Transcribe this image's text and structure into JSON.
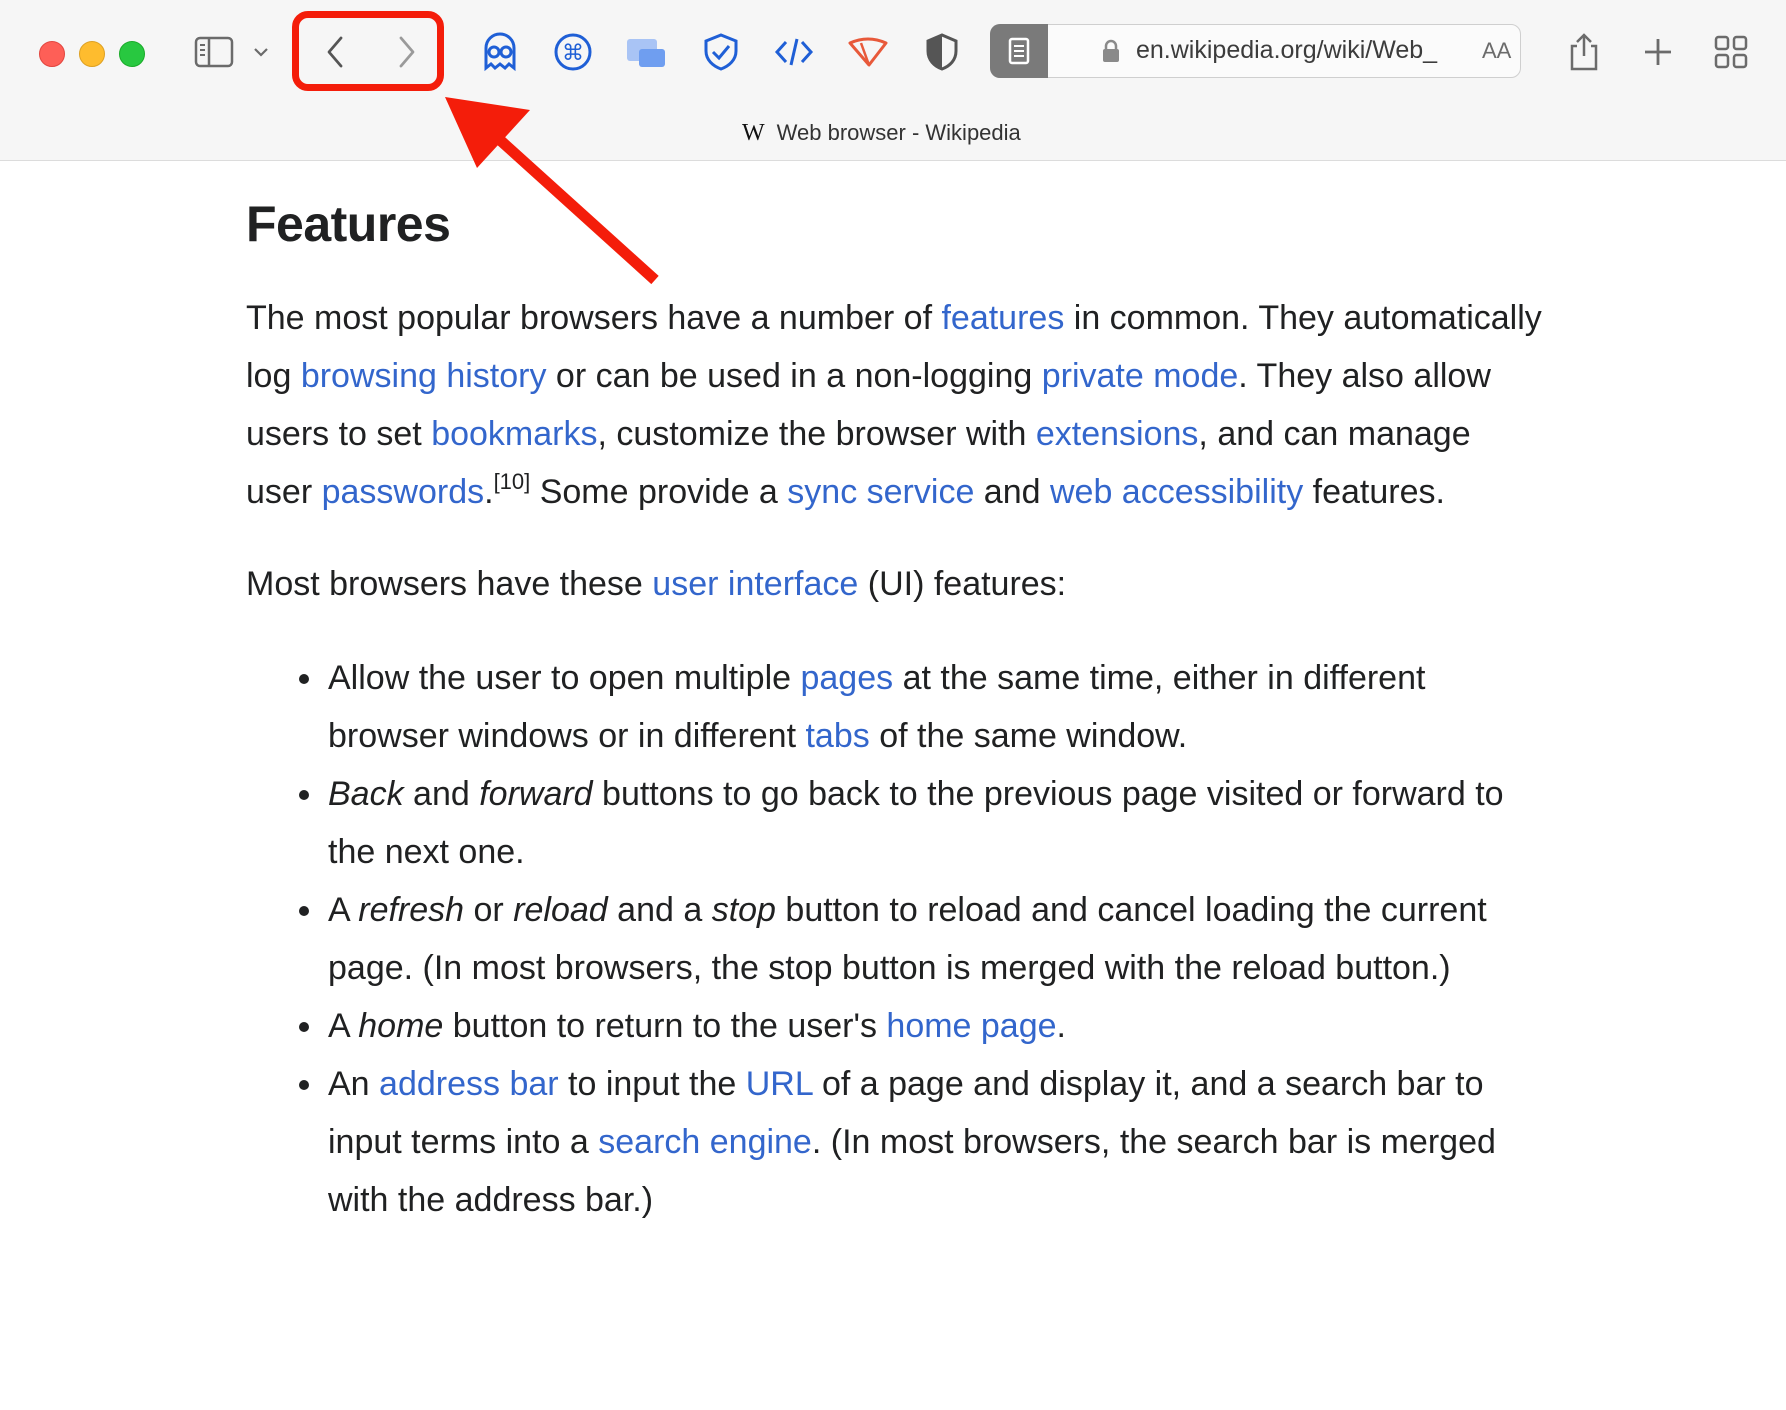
{
  "window": {
    "traffic_lights": [
      "close",
      "minimize",
      "zoom"
    ]
  },
  "toolbar": {
    "icons": [
      "sidebar-icon",
      "chevron-down-icon",
      "back-icon",
      "forward-icon",
      "ghost-extension-icon",
      "command-extension-icon",
      "picture-in-picture-extension-icon",
      "shield-check-extension-icon",
      "code-extension-icon",
      "wiper-extension-icon",
      "half-shield-extension-icon",
      "reader-icon",
      "share-icon",
      "new-tab-icon",
      "tab-overview-icon"
    ]
  },
  "address": {
    "url": "en.wikipedia.org/wiki/Web_",
    "aa": "AA"
  },
  "tab": {
    "logo": "W",
    "title": "Web browser - Wikipedia"
  },
  "article": {
    "heading": "Features",
    "p1": {
      "t1": "The most popular browsers have a number of ",
      "l1": "features",
      "t2": " in common. They automatically log ",
      "l2": "browsing history",
      "t3": " or can be used in a non-logging ",
      "l3": "private mode",
      "t4": ". They also allow users to set ",
      "l4": "bookmarks",
      "t5": ", customize the browser with ",
      "l5": "extensions",
      "t6": ", and can manage user ",
      "l6": "passwords",
      "t7": ".",
      "sup": "[10]",
      "t8": " Some provide a ",
      "l7": "sync service",
      "t9": " and ",
      "l8": "web accessibility",
      "t10": " features."
    },
    "p2": {
      "t1": "Most browsers have these ",
      "l1": "user interface",
      "t2": " (UI) features:"
    },
    "list": {
      "i1": {
        "t1": "Allow the user to open multiple ",
        "l1": "pages",
        "t2": " at the same time, either in different browser windows or in different ",
        "l2": "tabs",
        "t3": " of the same window."
      },
      "i2": {
        "e1": "Back",
        "t1": " and ",
        "e2": "forward",
        "t2": " buttons to go back to the previous page visited or forward to the next one."
      },
      "i3": {
        "t1": "A ",
        "e1": "refresh",
        "t2": " or ",
        "e2": "reload",
        "t3": " and a ",
        "e3": "stop",
        "t4": " button to reload and cancel loading the current page. (In most browsers, the stop button is merged with the reload button.)"
      },
      "i4": {
        "t1": "A ",
        "e1": "home",
        "t2": " button to return to the user's ",
        "l1": "home page",
        "t3": "."
      },
      "i5": {
        "t1": "An ",
        "l1": "address bar",
        "t2": " to input the ",
        "l2": "URL",
        "t3": " of a page and display it, and a search bar to input terms into a ",
        "l3": "search engine",
        "t4": ". (In most browsers, the search bar is merged with the address bar.)"
      }
    }
  },
  "annotation": {
    "color": "#f41d0a",
    "target": "back-forward-buttons"
  }
}
